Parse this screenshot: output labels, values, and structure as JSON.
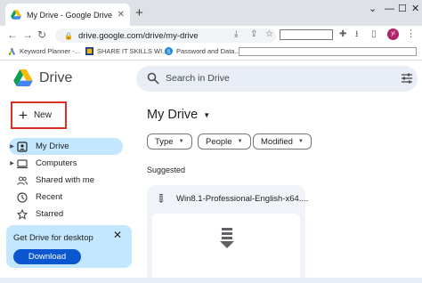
{
  "browser": {
    "tab_title": "My Drive - Google Drive",
    "url": "drive.google.com/drive/my-drive",
    "avatar_initials": "yl",
    "bookmarks": [
      {
        "label": "Keyword Planner -...",
        "icon": "google-ads-icon"
      },
      {
        "label": "SHARE IT SKILLS WI...",
        "icon": "bookmark-site-icon"
      },
      {
        "label": "Password and Data...",
        "icon": "bookmark-s-icon"
      }
    ]
  },
  "drive": {
    "brand": "Drive",
    "search_placeholder": "Search in Drive",
    "new_label": "New",
    "nav": [
      {
        "label": "My Drive",
        "icon": "my-drive-icon",
        "active": true,
        "caret": true
      },
      {
        "label": "Computers",
        "icon": "computer-icon",
        "active": false,
        "caret": true
      },
      {
        "label": "Shared with me",
        "icon": "people-icon",
        "active": false,
        "caret": false
      },
      {
        "label": "Recent",
        "icon": "clock-icon",
        "active": false,
        "caret": false
      },
      {
        "label": "Starred",
        "icon": "star-icon",
        "active": false,
        "caret": false
      }
    ],
    "promo": {
      "title": "Get Drive for desktop",
      "button": "Download"
    },
    "main": {
      "title": "My Drive",
      "filters": [
        "Type",
        "People",
        "Modified"
      ],
      "section": "Suggested",
      "file_name": "Win8.1-Professional-English-x64...."
    }
  },
  "colors": {
    "highlight_box": "#d93025",
    "active_nav": "#c2e7ff",
    "primary_button": "#0b57d0"
  }
}
